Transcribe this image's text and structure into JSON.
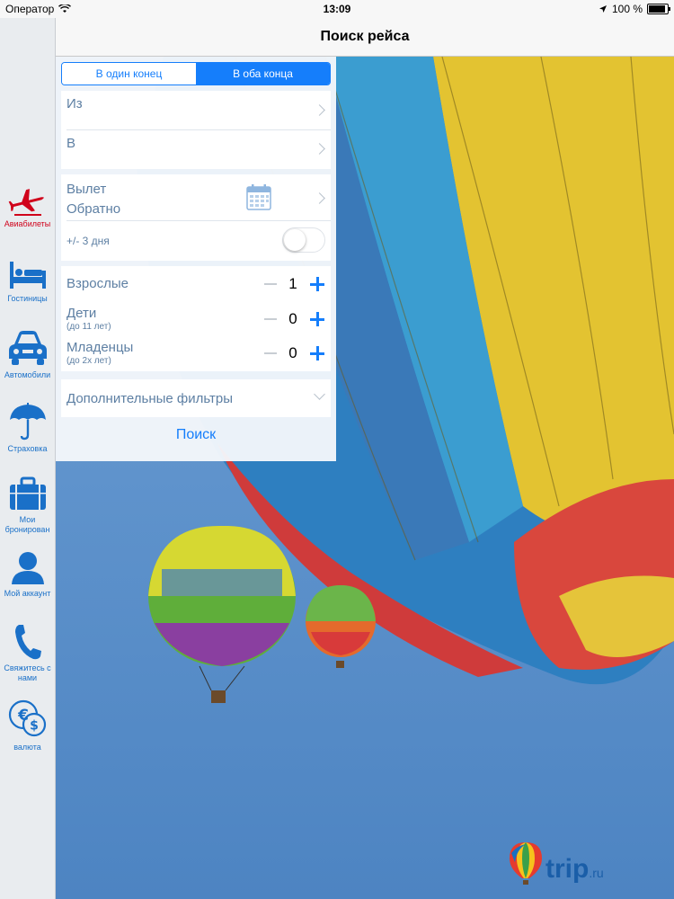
{
  "status_bar": {
    "carrier": "Оператор",
    "time": "13:09",
    "battery_label": "100 %",
    "battery_level": 1.0
  },
  "nav": {
    "title": "Поиск рейса"
  },
  "sidebar": {
    "items": [
      {
        "label": "Авиабилеты",
        "icon": "airplane-icon",
        "active": true
      },
      {
        "label": "Гостиницы",
        "icon": "bed-icon",
        "active": false
      },
      {
        "label": "Автомобили",
        "icon": "car-icon",
        "active": false
      },
      {
        "label": "Страховка",
        "icon": "umbrella-icon",
        "active": false
      },
      {
        "label": "Мои бронирован",
        "icon": "briefcase-icon",
        "active": false
      },
      {
        "label": "Мой аккаунт",
        "icon": "user-icon",
        "active": false
      },
      {
        "label": "Свяжитесь с нами",
        "icon": "phone-icon",
        "active": false
      },
      {
        "label": "валюта",
        "icon": "currency-icon",
        "active": false
      }
    ]
  },
  "form": {
    "trip_type": {
      "one_way": "В один конец",
      "round_trip": "В оба конца",
      "selected": "round_trip"
    },
    "from_label": "Из",
    "to_label": "В",
    "depart_label": "Вылет",
    "return_label": "Обратно",
    "flex_label": "+/- 3 дня",
    "flex_enabled": false,
    "adults": {
      "label": "Взрослые",
      "count": "1"
    },
    "children": {
      "label": "Дети",
      "note": "(до 11 лет)",
      "count": "0"
    },
    "infants": {
      "label": "Младенцы",
      "note": "(до 2х лет)",
      "count": "0"
    },
    "filters_label": "Дополнительные фильтры",
    "search_label": "Поиск"
  },
  "brand": {
    "logo_text": "trip",
    "logo_suffix": ".ru"
  },
  "colors": {
    "accent": "#157efb",
    "active_nav": "#d0021b",
    "nav_icons": "#1a70c8",
    "sky": "#5f93cc"
  }
}
